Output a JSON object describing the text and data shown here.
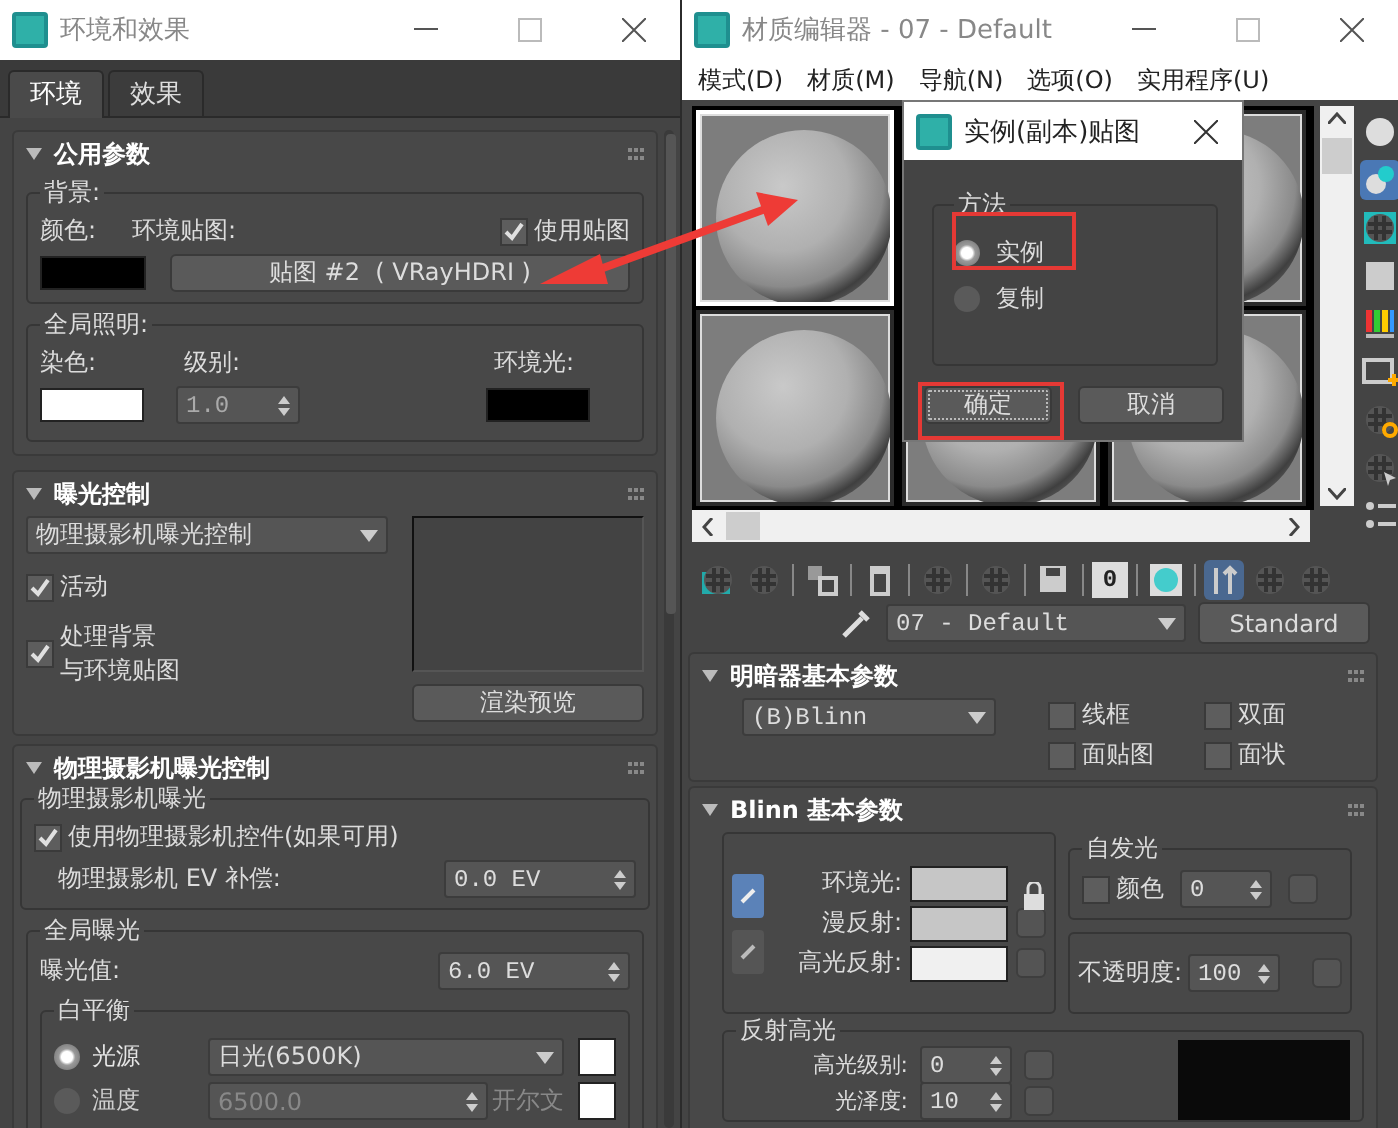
{
  "env_window": {
    "title": "环境和效果",
    "tabs": [
      {
        "label": "环境",
        "selected": true
      },
      {
        "label": "效果",
        "selected": false
      }
    ],
    "common_params": {
      "title": "公用参数",
      "background": {
        "label": "背景:",
        "color_label": "颜色:",
        "map_label": "环境贴图:",
        "use_map": {
          "label": "使用贴图",
          "checked": true
        },
        "map_button": "贴图 #2  ( VRayHDRI )"
      },
      "global_lighting": {
        "label": "全局照明:",
        "tint_label": "染色:",
        "level_label": "级别:",
        "level_value": "1.0",
        "ambient_label": "环境光:"
      }
    },
    "exposure_control": {
      "title": "曝光控制",
      "type_value": "物理摄影机曝光控制",
      "active": {
        "label": "活动",
        "checked": true
      },
      "process_background": {
        "label_lines": [
          "处理背景",
          "与环境贴图"
        ],
        "checked": true
      },
      "render_preview": "渲染预览"
    },
    "physical_camera_exposure": {
      "title": "物理摄影机曝光控制",
      "camera_group": {
        "label": "物理摄影机曝光",
        "use_controls": {
          "label": "使用物理摄影机控件(如果可用)",
          "checked": true
        },
        "ev_label": "物理摄影机 EV 补偿:",
        "ev_value": "0.0 EV"
      },
      "global_exposure": {
        "label": "全局曝光",
        "exposure_label": "曝光值:",
        "exposure_value": "6.0 EV",
        "white_balance": {
          "label": "白平衡",
          "options": [
            {
              "label": "光源",
              "selected": true,
              "value": "日光(6500K)",
              "kind": "dropdown",
              "disabled": false
            },
            {
              "label": "温度",
              "selected": false,
              "value": "6500.0",
              "kind": "spinner",
              "unit": "开尔文",
              "disabled": true
            }
          ]
        }
      }
    }
  },
  "material_editor": {
    "title": "材质编辑器 - 07 - Default",
    "menu": [
      "模式(D)",
      "材质(M)",
      "导航(N)",
      "选项(O)",
      "实用程序(U)"
    ],
    "sample_slots": [
      {
        "selected": true
      },
      {
        "selected": false
      },
      {
        "selected": false
      },
      {
        "selected": false
      },
      {
        "selected": false
      }
    ],
    "material_id": "0",
    "material_name": "07 - Default",
    "material_type": "Standard",
    "shader_params": {
      "title": "明暗器基本参数",
      "shader": "(B)Blinn",
      "options": [
        {
          "label": "线框",
          "checked": false
        },
        {
          "label": "双面",
          "checked": false
        },
        {
          "label": "面贴图",
          "checked": false
        },
        {
          "label": "面状",
          "checked": false
        }
      ]
    },
    "blinn_params": {
      "title": "Blinn 基本参数",
      "colors": [
        {
          "label": "环境光:",
          "map_slot": false
        },
        {
          "label": "漫反射:",
          "map_slot": true
        },
        {
          "label": "高光反射:",
          "map_slot": true
        }
      ],
      "self_illumination": {
        "label": "自发光",
        "color": {
          "label": "颜色",
          "checked": false
        },
        "value": "0"
      },
      "opacity_label": "不透明度:",
      "opacity_value": "100",
      "specular": {
        "label": "反射高光",
        "level_label": "高光级别:",
        "level_value": "0",
        "gloss_label": "光泽度:",
        "gloss_value": "10"
      }
    }
  },
  "dialog": {
    "title": "实例(副本)贴图",
    "method_label": "方法",
    "options": [
      {
        "label": "实例",
        "selected": true
      },
      {
        "label": "复制",
        "selected": false
      }
    ],
    "ok": "确定",
    "cancel": "取消"
  }
}
